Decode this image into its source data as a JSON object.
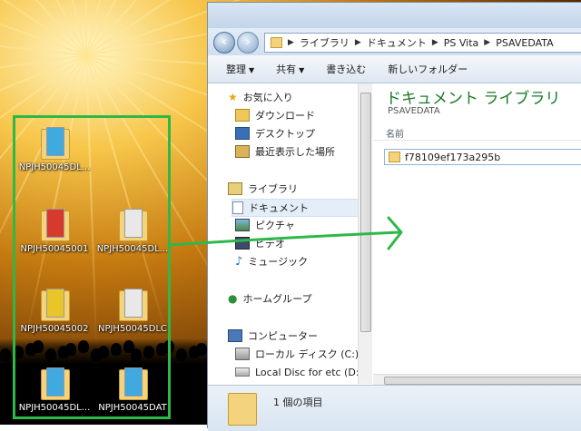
{
  "desktop": {
    "icons": [
      {
        "label": "NPJH50045DL...",
        "accent": "#3fa9e0"
      },
      {
        "label": "NPJH50045001",
        "accent": "#d63a2e"
      },
      {
        "label": "NPJH50045DL...",
        "accent": "#e8e8e8"
      },
      {
        "label": "NPJH50045002",
        "accent": "#e8c62a"
      },
      {
        "label": "NPJH50045DLC",
        "accent": "#e8e8e8"
      },
      {
        "label": "NPJH50045DL...",
        "accent": "#3fa9e0"
      },
      {
        "label": "NPJH50045DAT",
        "accent": "#3fa9e0"
      }
    ],
    "highlight_color": "#2eb84a"
  },
  "explorer": {
    "breadcrumbs": [
      "ライブラリ",
      "ドキュメント",
      "PS Vita",
      "PSAVEDATA"
    ],
    "toolbar": {
      "organize": "整理",
      "share": "共有",
      "burn": "書き込む",
      "new_folder": "新しいフォルダー"
    },
    "nav": {
      "favorites": "お気に入り",
      "downloads": "ダウンロード",
      "desktop": "デスクトップ",
      "recent": "最近表示した場所",
      "libraries": "ライブラリ",
      "documents": "ドキュメント",
      "pictures": "ピクチャ",
      "videos": "ビデオ",
      "music": "ミュージック",
      "homegroup": "ホームグループ",
      "computer": "コンピューター",
      "local_disk": "ローカル ディスク (C:)",
      "local_disc_etc": "Local Disc for etc (D:)"
    },
    "content": {
      "library_title": "ドキュメント ライブラリ",
      "library_subtitle": "PSAVEDATA",
      "column_name": "名前",
      "folder_name": "f78109ef173a295b"
    },
    "status": "1 個の項目"
  }
}
